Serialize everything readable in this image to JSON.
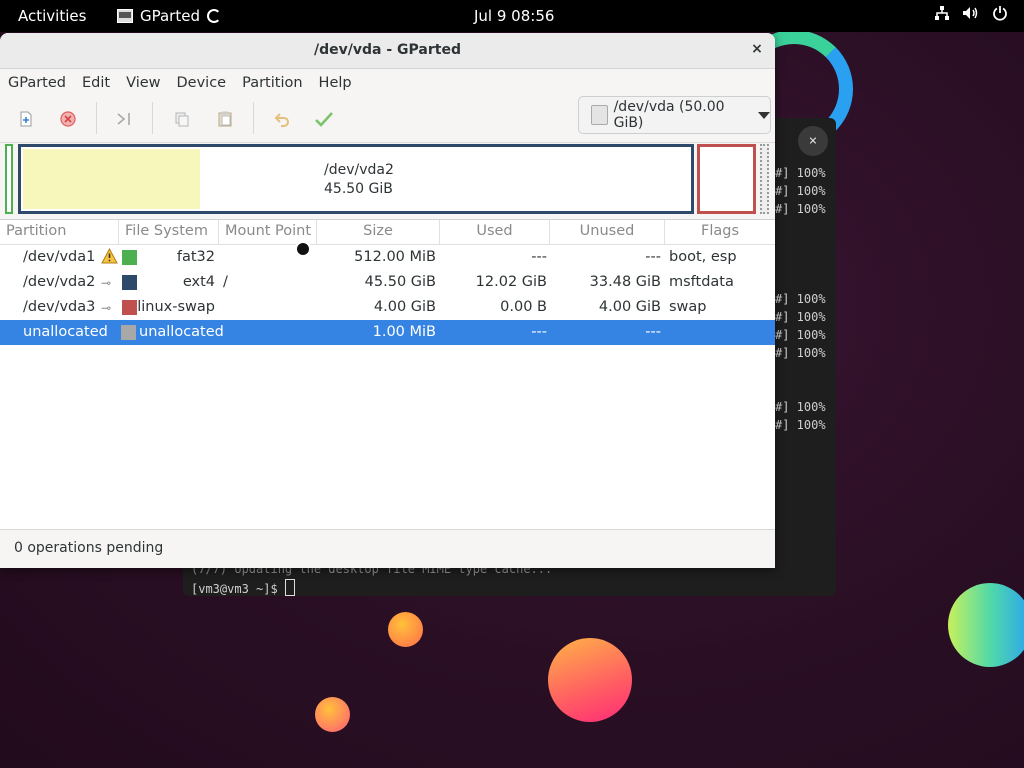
{
  "topbar": {
    "activities": "Activities",
    "app_name": "GParted",
    "clock": "Jul 9  08:56",
    "tray_icons": [
      "network-icon",
      "volume-icon",
      "power-icon"
    ]
  },
  "terminal": {
    "close_glyph": "×",
    "progress_lines": [
      "#] 100%",
      "#] 100%",
      "#] 100%",
      "#] 100%",
      "#] 100%",
      "#] 100%",
      "#] 100%",
      "#] 100%",
      "#] 100%"
    ],
    "cache_line": "(7/7) Updating the desktop file MIME type cache...",
    "prompt": "[vm3@vm3 ~]$ "
  },
  "window": {
    "title": "/dev/vda - GParted",
    "close_glyph": "×"
  },
  "menu": [
    "GParted",
    "Edit",
    "View",
    "Device",
    "Partition",
    "Help"
  ],
  "toolbar": {
    "icons": [
      "new-icon",
      "delete-icon",
      "resize-move-icon",
      "copy-icon",
      "paste-icon",
      "undo-icon",
      "apply-icon"
    ],
    "device_selector": "/dev/vda (50.00 GiB)"
  },
  "diskmap": {
    "main_label_line1": "/dev/vda2",
    "main_label_line2": "45.50 GiB"
  },
  "table": {
    "headers": [
      "Partition",
      "File System",
      "Mount Point",
      "Size",
      "Used",
      "Unused",
      "Flags"
    ],
    "rows": [
      {
        "partition": "/dev/vda1",
        "filesystem": "fat32",
        "mount": "",
        "size": "512.00 MiB",
        "used": "---",
        "unused": "---",
        "flags": "boot, esp",
        "color": "#4caf50",
        "icon": "warning"
      },
      {
        "partition": "/dev/vda2",
        "filesystem": "ext4",
        "mount": "/",
        "size": "45.50 GiB",
        "used": "12.02 GiB",
        "unused": "33.48 GiB",
        "flags": "msftdata",
        "color": "#2e4a6a",
        "icon": "key"
      },
      {
        "partition": "/dev/vda3",
        "filesystem": "linux-swap",
        "mount": "",
        "size": "4.00 GiB",
        "used": "0.00 B",
        "unused": "4.00 GiB",
        "flags": "swap",
        "color": "#c0504d",
        "icon": "key"
      },
      {
        "partition": "unallocated",
        "filesystem": "unallocated",
        "mount": "",
        "size": "1.00 MiB",
        "used": "---",
        "unused": "---",
        "flags": "",
        "color": "#a8a8a8",
        "icon": "",
        "selected": true
      }
    ]
  },
  "status": {
    "text": "0 operations pending"
  }
}
